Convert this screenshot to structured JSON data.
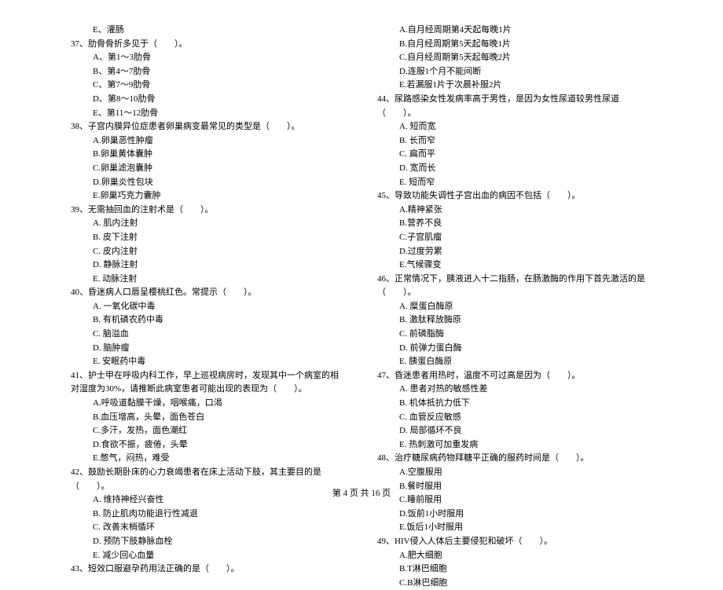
{
  "left": {
    "pre_options": [
      "E、灌肠"
    ],
    "questions": [
      {
        "num": "37、",
        "stem": "肋骨骨折多见于（　　）。",
        "options": [
          "A、第1～3肋骨",
          "B、第4～7肋骨",
          "C、第7～9肋骨",
          "D、第8～10肋骨",
          "E、第11～12肋骨"
        ]
      },
      {
        "num": "38、",
        "stem": "子宫内膜异位症患者卵巢病变最常见的类型是（　　）。",
        "options": [
          "A.卵巢恶性肿瘤",
          "B.卵巢黄体囊肿",
          "C.卵巢滤泡囊肿",
          "D.卵巢炎性包块",
          "E.卵巢巧克力囊肿"
        ]
      },
      {
        "num": "39、",
        "stem": "无需抽回血的注射术是（　　）。",
        "options": [
          "A. 肌内注射",
          "B. 皮下注射",
          "C. 皮内注射",
          "D. 静脉注射",
          "E. 动脉注射"
        ]
      },
      {
        "num": "40、",
        "stem": "昏迷病人口唇呈樱桃红色。常提示（　　）。",
        "options": [
          "A. 一氧化碳中毒",
          "B. 有机磷农药中毒",
          "C. 脑溢血",
          "D. 脑肿瘤",
          "E. 安眠药中毒"
        ]
      },
      {
        "num": "41、",
        "stem": "护士甲在呼吸内科工作，早上巡视病房时，发现其中一个病室的相对湿度为30%，请推断此病室患者可能出现的表现为（　　）。",
        "options": [
          "A.呼吸道黏膜干燥，咽喉痛，口渴",
          "B.血压增高，头晕，面色苍白",
          "C.多汗，发热，面色潮红",
          "D.食欲不振，疲倦，头晕",
          "E.憋气，闷热，难受"
        ]
      },
      {
        "num": "42、",
        "stem": "鼓励长期卧床的心力衰竭患者在床上活动下肢，其主要目的是（　　）。",
        "options": [
          "A. 维持神经兴奋性",
          "B. 防止肌肉功能退行性减退",
          "C. 改善末梢循环",
          "D. 预防下肢静脉血栓",
          "E. 减少回心血量"
        ]
      },
      {
        "num": "43、",
        "stem": "短效口服避孕药用法正确的是（　　）。",
        "options": []
      }
    ]
  },
  "right": {
    "pre_options": [
      "A.自月经周期第4天起每晚1片",
      "B.自月经周期第5天起每晚1片",
      "C.自月经周期第5天起每晚2片",
      "D.连服1个月不能间断",
      "E.若漏服1片于次晨补服2片"
    ],
    "questions": [
      {
        "num": "44、",
        "stem": "尿路感染女性发病率高于男性，是因为女性尿道较男性尿道（　　）。",
        "options": [
          "A. 短而宽",
          "B. 长而窄",
          "C. 扁而平",
          "D. 宽而长",
          "E. 短而窄"
        ]
      },
      {
        "num": "45、",
        "stem": "导致功能失调性子宫出血的病因不包括（　　）。",
        "options": [
          "A.精神紧张",
          "B.营养不良",
          "C.子宫肌瘤",
          "D.过度劳累",
          "E.气候骤变"
        ]
      },
      {
        "num": "46、",
        "stem": "正常情况下，胰液进入十二指肠，在肠激酶的作用下首先激活的是（　　）。",
        "options": [
          "A. 糜蛋白酶原",
          "B. 激肽释放酶原",
          "C. 前磷脂酶",
          "D. 前弹力蛋白酶",
          "E. 胰蛋白酶原"
        ]
      },
      {
        "num": "47、",
        "stem": "昏迷患者用热时，温度不可过高是因为（　　）。",
        "options": [
          "A. 患者对热的敏感性差",
          "B. 机体抵抗力低下",
          "C. 血管反应敏感",
          "D. 局部循环不良",
          "E. 热刺激可加重发病"
        ]
      },
      {
        "num": "48、",
        "stem": "治疗糖尿病药物拜糖平正确的服药时间是（　　）。",
        "options": [
          "A.空腹服用",
          "B.餐时服用",
          "C.睡前服用",
          "D.饭前1小时服用",
          "E.饭后1小时服用"
        ]
      },
      {
        "num": "49、",
        "stem": "HIV侵入人体后主要侵犯和破坏（　　）。",
        "options": [
          "A.肥大细胞",
          "B.T淋巴细胞",
          "C.B淋巴细胞"
        ]
      }
    ]
  },
  "footer": "第 4 页 共 16 页"
}
